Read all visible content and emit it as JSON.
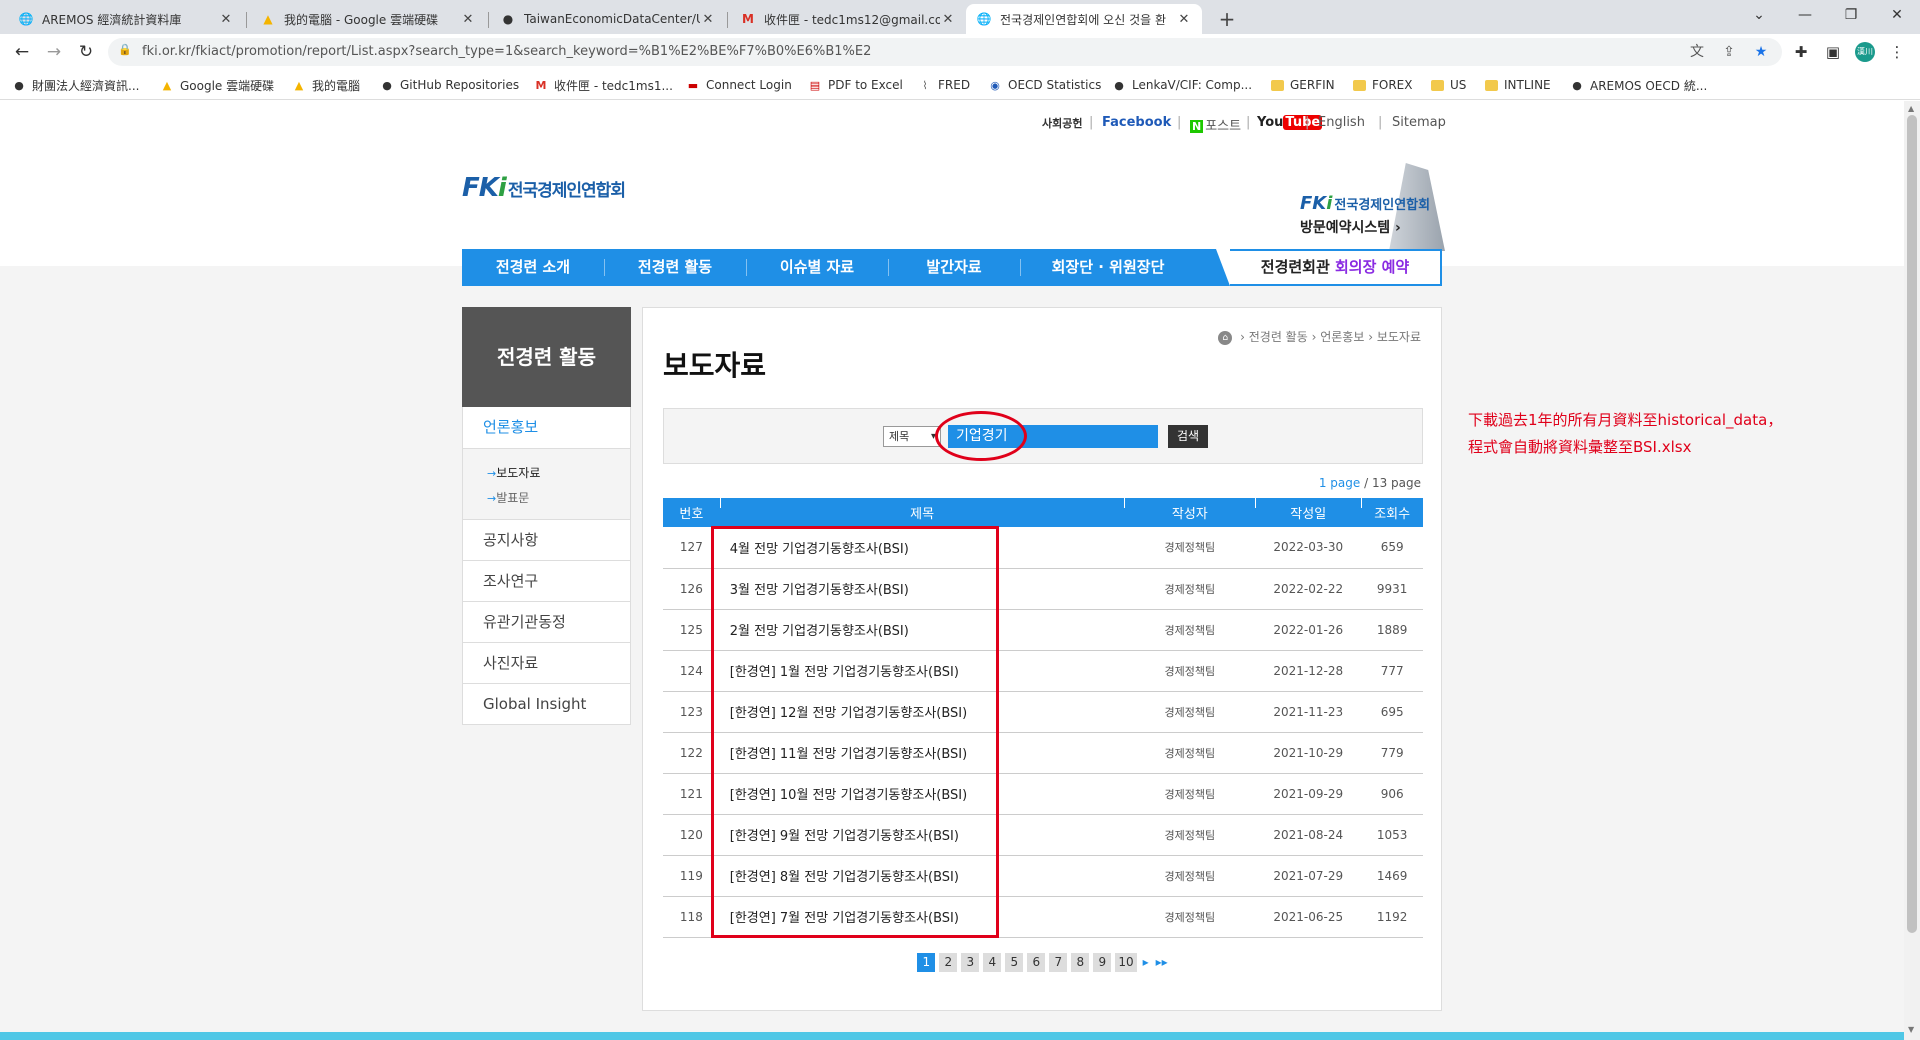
{
  "browser": {
    "tabs": [
      {
        "title": "AREMOS 經濟統計資料庫",
        "icon": "globe-icon"
      },
      {
        "title": "我的電腦 - Google 雲端硬碟",
        "icon": "google-drive-icon"
      },
      {
        "title": "TaiwanEconomicDataCenter/U",
        "icon": "github-icon"
      },
      {
        "title": "收件匣 - tedc1ms12@gmail.co",
        "icon": "gmail-icon"
      },
      {
        "title": "전국경제인연합회에 오신 것을 환",
        "icon": "globe-icon",
        "active": true
      }
    ],
    "new_tab": "+",
    "url": "fki.or.kr/fkiact/promotion/report/List.aspx?search_type=1&search_keyword=%B1%E2%BE%F7%B0%E6%B1%E2",
    "profile_label": "漢川",
    "bookmarks": [
      {
        "label": "財團法人經濟資訊...",
        "icon": "globe-icon"
      },
      {
        "label": "Google 雲端硬碟",
        "icon": "google-drive-icon"
      },
      {
        "label": "我的電腦",
        "icon": "google-drive-icon"
      },
      {
        "label": "GitHub Repositories",
        "icon": "github-icon"
      },
      {
        "label": "收件匣 - tedc1ms1...",
        "icon": "gmail-icon"
      },
      {
        "label": "Connect Login",
        "icon": "flag-icon"
      },
      {
        "label": "PDF to Excel",
        "icon": "pdf-icon"
      },
      {
        "label": "FRED",
        "icon": "chart-icon"
      },
      {
        "label": "OECD Statistics",
        "icon": "oecd-icon"
      },
      {
        "label": "LenkaV/CIF: Comp...",
        "icon": "github-icon"
      },
      {
        "label": "GERFIN",
        "icon": "folder-icon"
      },
      {
        "label": "FOREX",
        "icon": "folder-icon"
      },
      {
        "label": "US",
        "icon": "folder-icon"
      },
      {
        "label": "INTLINE",
        "icon": "folder-icon"
      },
      {
        "label": "AREMOS OECD 統...",
        "icon": "globe-icon"
      }
    ]
  },
  "site": {
    "util": {
      "blog": "사회공헌",
      "facebook": "Facebook",
      "post_n": "N",
      "post": "포스트",
      "youtube_you": "You",
      "youtube_tube": "Tube",
      "english": "English",
      "sitemap": "Sitemap",
      "sep": "|"
    },
    "logo_mark_a": "FK",
    "logo_mark_b": "i",
    "logo_name": "전국경제인연합회",
    "booking_logo_a": "FK",
    "booking_logo_b": "i",
    "booking_name": "전국경제인연합회",
    "booking_system": "방문예약시스템 ›",
    "gnb": [
      "전경련 소개",
      "전경련 활동",
      "이슈별 자료",
      "발간자료",
      "회장단 · 위원장단"
    ],
    "gnb_special_a": "전경련회관 ",
    "gnb_special_b": "회의장 예약"
  },
  "side": {
    "title": "전경련 활동",
    "current": "언론홍보",
    "sub": [
      {
        "label": "보도자료",
        "on": true
      },
      {
        "label": "발표문",
        "on": false
      }
    ],
    "sub_arrow": "→",
    "menu": [
      "공지사항",
      "조사연구",
      "유관기관동정",
      "사진자료",
      "Global Insight"
    ]
  },
  "content": {
    "breadcrumb": {
      "home": "⌂",
      "items": [
        "전경련 활동",
        "언론홍보",
        "보도자료"
      ],
      "sep": " › "
    },
    "title": "보도자료",
    "search": {
      "type": "제목",
      "keyword": "기업경기",
      "button": "검색"
    },
    "page_info": {
      "current": "1 page",
      "total": " / 13 page"
    },
    "columns": [
      "번호",
      "제목",
      "작성자",
      "작성일",
      "조회수"
    ],
    "rows": [
      {
        "no": "127",
        "title": "4월 전망 기업경기동향조사(BSI)",
        "author": "경제정책팀",
        "date": "2022-03-30",
        "views": "659"
      },
      {
        "no": "126",
        "title": "3월 전망 기업경기동향조사(BSI)",
        "author": "경제정책팀",
        "date": "2022-02-22",
        "views": "9931"
      },
      {
        "no": "125",
        "title": "2월 전망 기업경기동향조사(BSI)",
        "author": "경제정책팀",
        "date": "2022-01-26",
        "views": "1889"
      },
      {
        "no": "124",
        "title": "[한경연] 1월 전망 기업경기동향조사(BSI)",
        "author": "경제정책팀",
        "date": "2021-12-28",
        "views": "777"
      },
      {
        "no": "123",
        "title": "[한경연] 12월 전망 기업경기동향조사(BSI)",
        "author": "경제정책팀",
        "date": "2021-11-23",
        "views": "695"
      },
      {
        "no": "122",
        "title": "[한경연] 11월 전망 기업경기동향조사(BSI)",
        "author": "경제정책팀",
        "date": "2021-10-29",
        "views": "779"
      },
      {
        "no": "121",
        "title": "[한경연] 10월 전망 기업경기동향조사(BSI)",
        "author": "경제정책팀",
        "date": "2021-09-29",
        "views": "906"
      },
      {
        "no": "120",
        "title": "[한경연] 9월 전망 기업경기동향조사(BSI)",
        "author": "경제정책팀",
        "date": "2021-08-24",
        "views": "1053"
      },
      {
        "no": "119",
        "title": "[한경연] 8월 전망 기업경기동향조사(BSI)",
        "author": "경제정책팀",
        "date": "2021-07-29",
        "views": "1469"
      },
      {
        "no": "118",
        "title": "[한경연] 7월 전망 기업경기동향조사(BSI)",
        "author": "경제정책팀",
        "date": "2021-06-25",
        "views": "1192"
      }
    ],
    "pages": [
      "1",
      "2",
      "3",
      "4",
      "5",
      "6",
      "7",
      "8",
      "9",
      "10"
    ],
    "next": "▸",
    "last": "▸▸"
  },
  "annotation": {
    "line1": "下載過去1年的所有月資料至historical_data，",
    "line2": "程式會自動將資料彙整至BSI.xlsx",
    "color": "#e0001a"
  },
  "colors": {
    "primary": "#1f8fe6",
    "side_head": "#555555",
    "annotation_red": "#e0001a"
  }
}
